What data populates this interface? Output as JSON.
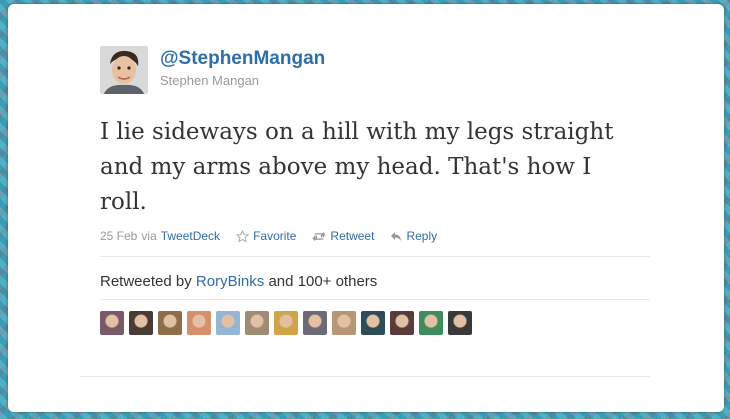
{
  "tweet": {
    "screen_name": "@StephenMangan",
    "full_name": "Stephen Mangan",
    "text": "I lie sideways on a hill with my legs straight and my arms above my head. That's how I roll.",
    "date": "25 Feb",
    "via": "via",
    "source": "TweetDeck"
  },
  "actions": {
    "favorite": "Favorite",
    "retweet": "Retweet",
    "reply": "Reply"
  },
  "retweets": {
    "prefix": "Retweeted by",
    "user": "RoryBinks",
    "suffix": "and 100+ others",
    "avatars": [
      {
        "name": "retweeter-1",
        "color": "#7a5a68"
      },
      {
        "name": "retweeter-2",
        "color": "#4a3b36"
      },
      {
        "name": "retweeter-3",
        "color": "#8c6e4b"
      },
      {
        "name": "retweeter-4",
        "color": "#d58f6a"
      },
      {
        "name": "retweeter-5",
        "color": "#93b6d6"
      },
      {
        "name": "retweeter-6",
        "color": "#9e8b73"
      },
      {
        "name": "retweeter-7",
        "color": "#d2a44a"
      },
      {
        "name": "retweeter-8",
        "color": "#6d6a78"
      },
      {
        "name": "retweeter-9",
        "color": "#b79676"
      },
      {
        "name": "retweeter-10",
        "color": "#2f4d58"
      },
      {
        "name": "retweeter-11",
        "color": "#5a3d3a"
      },
      {
        "name": "retweeter-12",
        "color": "#3f8c5f"
      },
      {
        "name": "retweeter-13",
        "color": "#3a3a3a"
      }
    ]
  },
  "colors": {
    "link": "#2f6ea6",
    "text": "#333333",
    "muted": "#999999",
    "background": "#3fa7c0"
  }
}
